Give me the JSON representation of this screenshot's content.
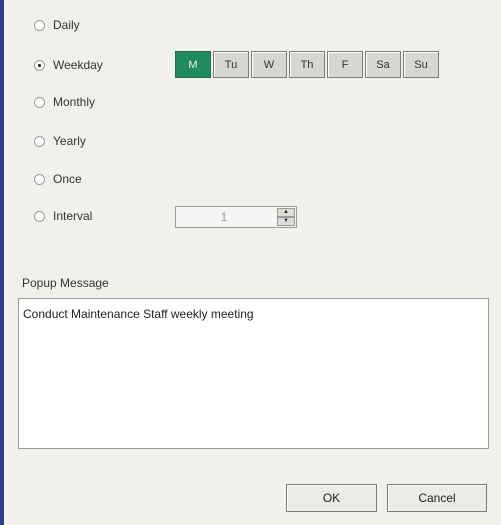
{
  "schedule": {
    "options": [
      {
        "label": "Daily",
        "checked": false
      },
      {
        "label": "Weekday",
        "checked": true
      },
      {
        "label": "Monthly",
        "checked": false
      },
      {
        "label": "Yearly",
        "checked": false
      },
      {
        "label": "Once",
        "checked": false
      },
      {
        "label": "Interval",
        "checked": false
      }
    ],
    "days": [
      {
        "label": "M",
        "selected": true
      },
      {
        "label": "Tu",
        "selected": false
      },
      {
        "label": "W",
        "selected": false
      },
      {
        "label": "Th",
        "selected": false
      },
      {
        "label": "F",
        "selected": false
      },
      {
        "label": "Sa",
        "selected": false
      },
      {
        "label": "Su",
        "selected": false
      }
    ],
    "interval_value": "1"
  },
  "popup": {
    "label": "Popup Message",
    "message": "Conduct Maintenance Staff weekly meeting"
  },
  "buttons": {
    "ok": "OK",
    "cancel": "Cancel"
  },
  "colors": {
    "selected_day": "#1f8a5a",
    "window_bg": "#f2f0ea",
    "accent_strip": "#2b3f8c"
  }
}
